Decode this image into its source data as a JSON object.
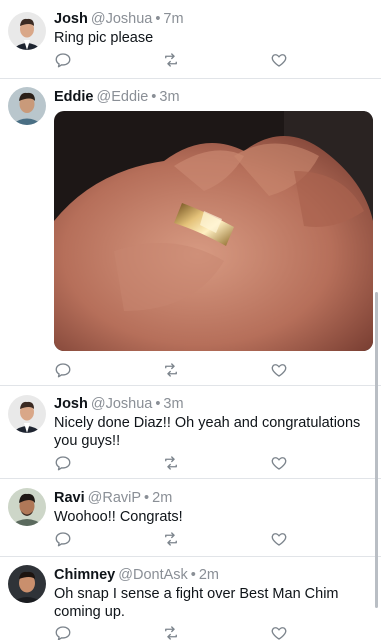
{
  "tweets": [
    {
      "name": "Josh",
      "handle": "@Joshua",
      "dot": "•",
      "time": "7m",
      "text": "Ring pic please"
    },
    {
      "name": "Eddie",
      "handle": "@Eddie",
      "dot": "•",
      "time": "3m",
      "text": "",
      "media": "ring-on-hand-photo"
    },
    {
      "name": "Josh",
      "handle": "@Joshua",
      "dot": "•",
      "time": "3m",
      "text": "Nicely done Diaz!! Oh yeah and congratulations you guys!!"
    },
    {
      "name": "Ravi",
      "handle": "@RaviP",
      "dot": "•",
      "time": "2m",
      "text": "Woohoo!! Congrats!"
    },
    {
      "name": "Chimney",
      "handle": "@DontAsk",
      "dot": "•",
      "time": "2m",
      "text": "Oh snap I sense a fight over Best Man Chim coming up."
    }
  ],
  "icons": {
    "reply": "reply-icon",
    "retweet": "retweet-icon",
    "like": "like-icon"
  },
  "colors": {
    "icon": "#7c848c",
    "divider": "#e1e4e8",
    "secondary_text": "#8a8f96"
  }
}
